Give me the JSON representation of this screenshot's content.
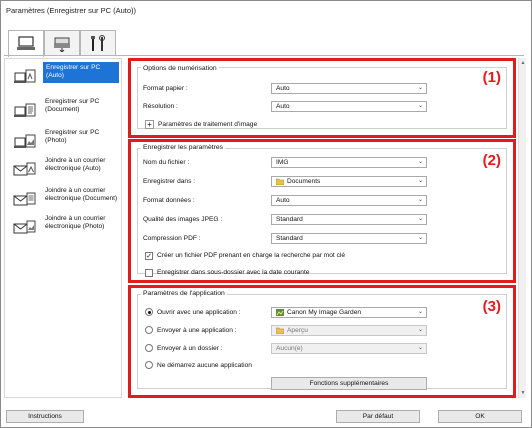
{
  "window": {
    "title": "Paramètres (Enregistrer sur PC (Auto))"
  },
  "tabs": [
    {
      "name": "scan-from-computer",
      "icon": "computer-icon"
    },
    {
      "name": "scan-from-operation-panel",
      "icon": "scanner-icon"
    },
    {
      "name": "general-settings",
      "icon": "tools-icon"
    }
  ],
  "sidebar": {
    "items": [
      {
        "label": "Enregistrer sur PC (Auto)",
        "icon": "computer-auto-icon",
        "selected": true
      },
      {
        "label": "Enregistrer sur PC (Document)",
        "icon": "computer-document-icon",
        "selected": false
      },
      {
        "label": "Enregistrer sur PC (Photo)",
        "icon": "computer-photo-icon",
        "selected": false
      },
      {
        "label": "Joindre à un courrier électronique (Auto)",
        "icon": "mail-auto-icon",
        "selected": false
      },
      {
        "label": "Joindre à un courrier électronique (Document)",
        "icon": "mail-document-icon",
        "selected": false
      },
      {
        "label": "Joindre à un courrier électronique (Photo)",
        "icon": "mail-photo-icon",
        "selected": false
      }
    ]
  },
  "scan_options": {
    "title": "Options de numérisation",
    "number": "(1)",
    "paper_size_label": "Format papier :",
    "paper_size_value": "Auto",
    "resolution_label": "Résolution :",
    "resolution_value": "Auto",
    "image_processing_label": "Paramètres de traitement d'image",
    "image_processing_button": "+"
  },
  "save_settings": {
    "title": "Enregistrer les paramètres",
    "number": "(2)",
    "file_name_label": "Nom du fichier :",
    "file_name_value": "IMG",
    "save_in_label": "Enregistrer dans :",
    "save_in_value": "Documents",
    "data_format_label": "Format données :",
    "data_format_value": "Auto",
    "jpeg_quality_label": "Qualité des images JPEG :",
    "jpeg_quality_value": "Standard",
    "pdf_compression_label": "Compression PDF :",
    "pdf_compression_value": "Standard",
    "searchable_pdf_label": "Créer un fichier PDF prenant en charge la recherche par mot clé",
    "searchable_pdf_checked": true,
    "subfolder_label": "Enregistrer dans sous-dossier avec la date courante",
    "subfolder_checked": false
  },
  "app_settings": {
    "title": "Paramètres de l'application",
    "number": "(3)",
    "open_app_label": "Ouvrir avec une application :",
    "open_app_value": "Canon My Image Garden",
    "send_app_label": "Envoyer à une application :",
    "send_app_value": "Aperçu",
    "send_folder_label": "Envoyer à un dossier :",
    "send_folder_value": "Aucun(e)",
    "no_app_label": "Ne démarrez aucune application",
    "selected_option": "open_app",
    "more_functions_button": "Fonctions supplémentaires"
  },
  "footer": {
    "instructions_button": "Instructions",
    "defaults_button": "Par défaut",
    "ok_button": "OK"
  },
  "colors": {
    "highlight": "#e21b1b",
    "selection": "#1e73d6"
  }
}
